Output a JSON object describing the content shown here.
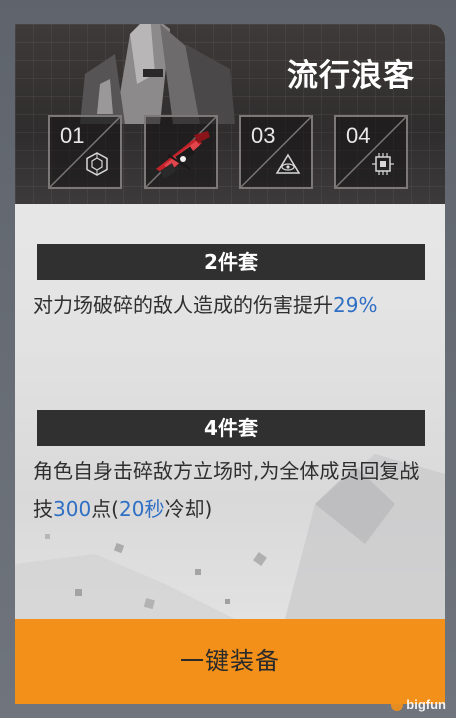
{
  "set": {
    "name": "流行浪客"
  },
  "slots": [
    {
      "label": "01",
      "icon": "hexagon-gear-icon",
      "equipped": false
    },
    {
      "label": "",
      "icon": "red-rifle-item",
      "equipped": true
    },
    {
      "label": "03",
      "icon": "triangle-eye-icon",
      "equipped": false
    },
    {
      "label": "04",
      "icon": "chip-icon",
      "equipped": false
    }
  ],
  "bonuses": [
    {
      "title": "2件套",
      "text_before": "对力场破碎的敌人造成的伤害提升",
      "hl1": "29%",
      "text_mid": "",
      "hl2": "",
      "text_after": ""
    },
    {
      "title": "4件套",
      "text_before": "角色自身击碎敌方立场时,为全体成员回复战技",
      "hl1": "300",
      "text_mid": "点(",
      "hl2": "20秒",
      "text_after": "冷却)"
    }
  ],
  "actions": {
    "equip_label": "一键装备"
  },
  "watermark": {
    "text": "bigfun"
  },
  "colors": {
    "accent_orange": "#f39019",
    "highlight_blue": "#2f6fc4",
    "header_dark": "#3e3a39"
  }
}
